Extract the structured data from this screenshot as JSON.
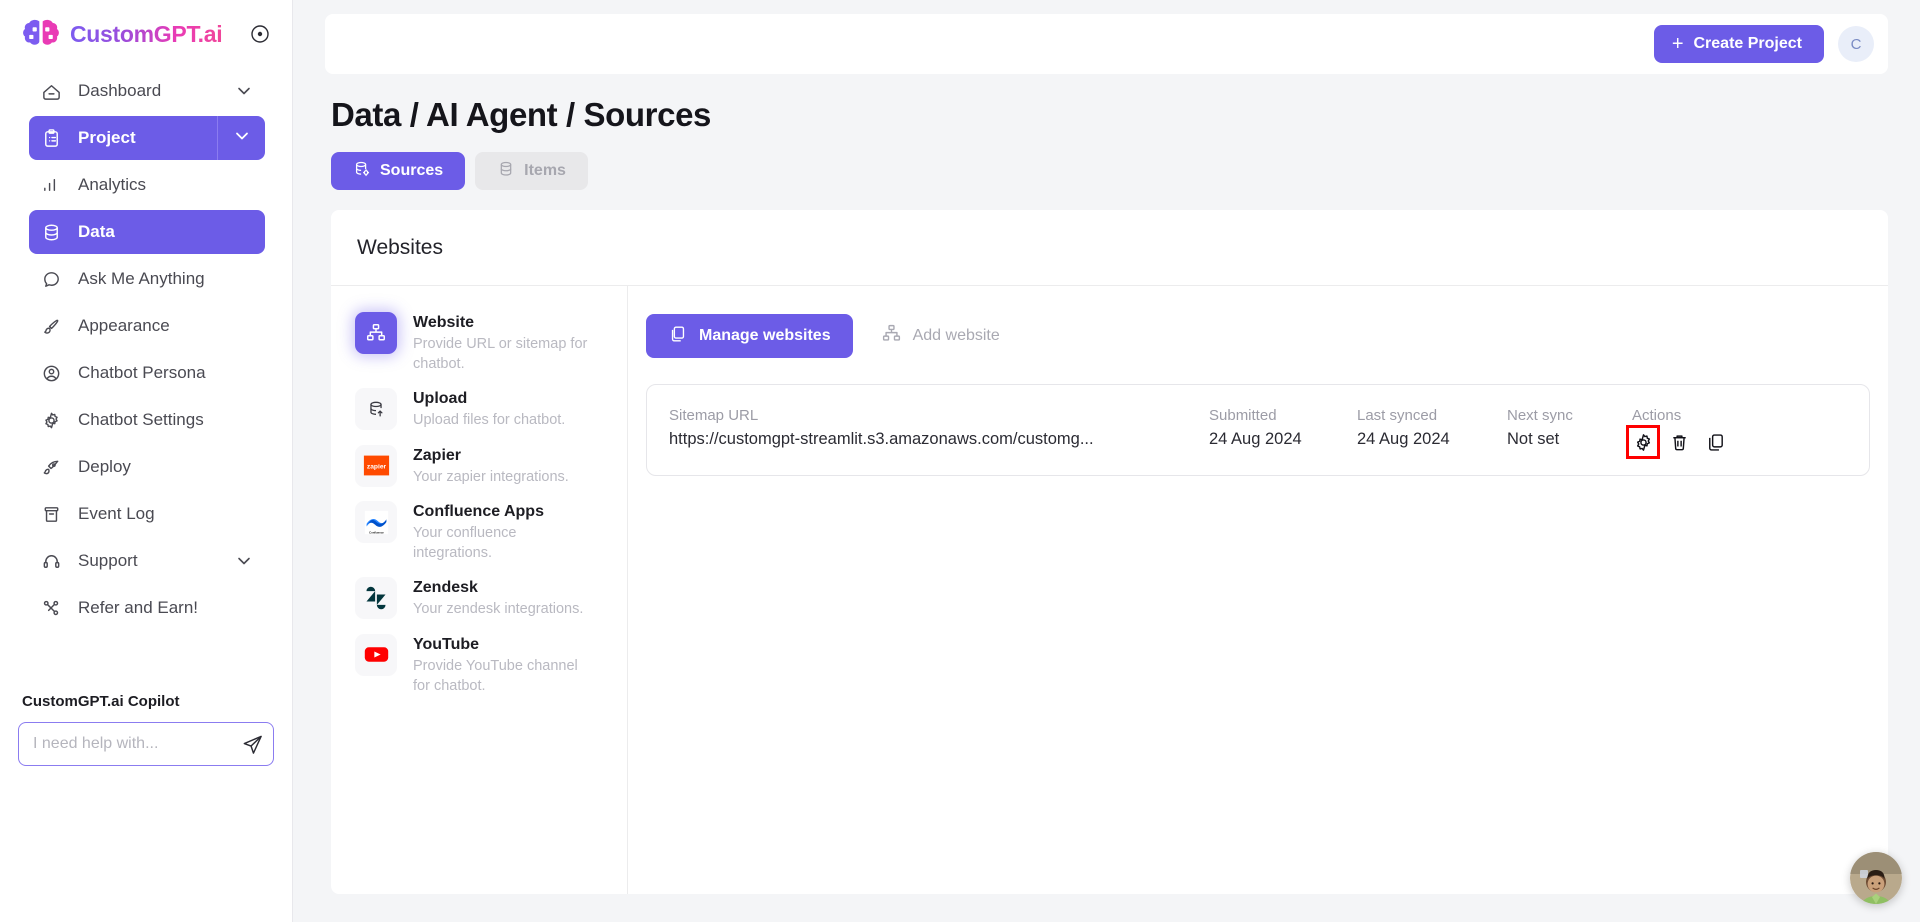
{
  "brand": {
    "name": "CustomGPT.ai",
    "target_icon": "target-icon"
  },
  "sidebar": {
    "items": [
      {
        "label": "Dashboard",
        "icon": "home-icon",
        "chevron": true,
        "active": false,
        "sub": false
      },
      {
        "label": "Project",
        "icon": "clipboard-icon",
        "chevron": true,
        "active": true,
        "sub": false
      },
      {
        "label": "Analytics",
        "icon": "bar-chart-icon",
        "chevron": false,
        "active": false,
        "sub": true
      },
      {
        "label": "Data",
        "icon": "database-icon",
        "chevron": false,
        "active": true,
        "sub": true
      },
      {
        "label": "Ask Me Anything",
        "icon": "chat-bubble-icon",
        "chevron": false,
        "active": false,
        "sub": true
      },
      {
        "label": "Appearance",
        "icon": "paintbrush-icon",
        "chevron": false,
        "active": false,
        "sub": true
      },
      {
        "label": "Chatbot Persona",
        "icon": "user-circle-icon",
        "chevron": false,
        "active": false,
        "sub": true
      },
      {
        "label": "Chatbot Settings",
        "icon": "gear-icon",
        "chevron": false,
        "active": false,
        "sub": true
      },
      {
        "label": "Deploy",
        "icon": "rocket-icon",
        "chevron": false,
        "active": false,
        "sub": true
      },
      {
        "label": "Event Log",
        "icon": "archive-icon",
        "chevron": false,
        "active": false,
        "sub": true
      },
      {
        "label": "Support",
        "icon": "headset-icon",
        "chevron": true,
        "active": false,
        "sub": true
      },
      {
        "label": "Refer and Earn!",
        "icon": "share-nodes-icon",
        "chevron": false,
        "active": false,
        "sub": true
      }
    ],
    "copilot": {
      "title": "CustomGPT.ai Copilot",
      "placeholder": "I need help with...",
      "value": "",
      "send_icon": "send-icon"
    }
  },
  "topbar": {
    "create_label": "Create Project",
    "plus": "+",
    "avatar_initial": "C"
  },
  "page": {
    "title": "Data / AI Agent / Sources",
    "tabs": [
      {
        "label": "Sources",
        "icon": "database-gear-icon",
        "active": true
      },
      {
        "label": "Items",
        "icon": "database-icon",
        "active": false
      }
    ]
  },
  "card": {
    "heading": "Websites",
    "sources": [
      {
        "name": "Website",
        "desc": "Provide URL or sitemap for chatbot.",
        "icon": "sitemap-icon",
        "selected": true
      },
      {
        "name": "Upload",
        "desc": "Upload files for chatbot.",
        "icon": "database-upload-icon",
        "selected": false
      },
      {
        "name": "Zapier",
        "desc": "Your zapier integrations.",
        "icon": "zapier-logo-icon",
        "selected": false
      },
      {
        "name": "Confluence Apps",
        "desc": "Your confluence integrations.",
        "icon": "confluence-logo-icon",
        "selected": false
      },
      {
        "name": "Zendesk",
        "desc": "Your zendesk integrations.",
        "icon": "zendesk-logo-icon",
        "selected": false
      },
      {
        "name": "YouTube",
        "desc": "Provide YouTube channel for chatbot.",
        "icon": "youtube-logo-icon",
        "selected": false
      }
    ],
    "actions": {
      "manage_label": "Manage websites",
      "manage_icon": "copy-icon",
      "add_label": "Add website",
      "add_icon": "sitemap-icon"
    },
    "table": {
      "headers": [
        "Sitemap URL",
        "Submitted",
        "Last synced",
        "Next sync",
        "Actions"
      ],
      "rows": [
        {
          "url": "https://customgpt-streamlit.s3.amazonaws.com/customg...",
          "submitted": "24 Aug 2024",
          "last_synced": "24 Aug 2024",
          "next_sync": "Not set",
          "actions": [
            "gear-icon",
            "trash-icon",
            "copy-icon"
          ]
        }
      ]
    }
  },
  "annotation": {
    "highlight_color": "#fe0000",
    "highlight_target": "gear-icon",
    "arrow": "up-arrow"
  },
  "chat_widget": {
    "icon": "support-agent-avatar"
  }
}
